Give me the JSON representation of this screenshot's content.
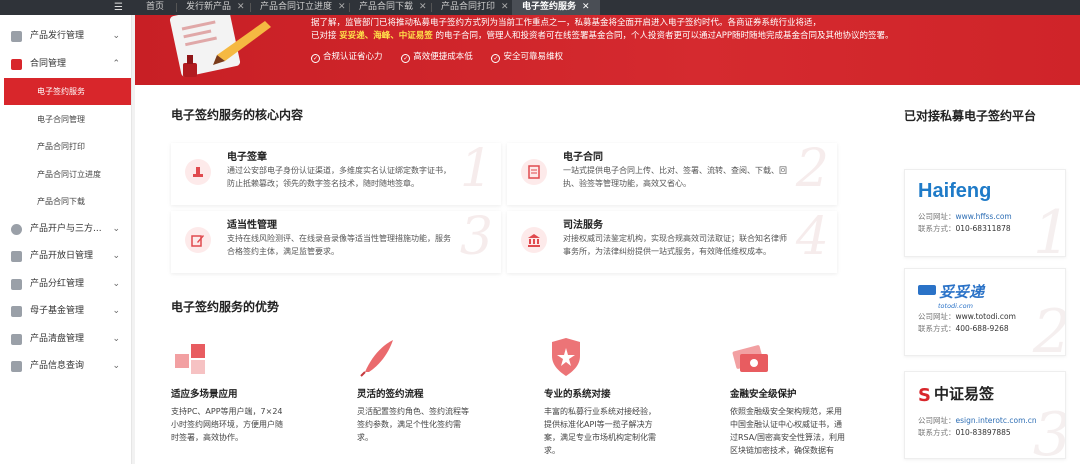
{
  "tabs": [
    {
      "label": "首页",
      "active": false
    },
    {
      "label": "发行新产品",
      "active": false
    },
    {
      "label": "产品合同订立进度",
      "active": false
    },
    {
      "label": "产品合同下载",
      "active": false
    },
    {
      "label": "产品合同打印",
      "active": false
    },
    {
      "label": "电子签约服务",
      "active": true
    }
  ],
  "sidebar": {
    "items": [
      {
        "label": "产品发行管理"
      },
      {
        "label": "合同管理"
      },
      {
        "label": "产品开户与三方..."
      },
      {
        "label": "产品开放日管理"
      },
      {
        "label": "产品分红管理"
      },
      {
        "label": "母子基金管理"
      },
      {
        "label": "产品清盘管理"
      },
      {
        "label": "产品信息查询"
      }
    ],
    "sub": [
      {
        "label": "电子签约服务"
      },
      {
        "label": "电子合同管理"
      },
      {
        "label": "产品合同打印"
      },
      {
        "label": "产品合同订立进度"
      },
      {
        "label": "产品合同下载"
      }
    ]
  },
  "banner": {
    "line1": "据了解，监管部门已将推动私募电子签约方式列为当前工作重点之一，私募基金将全面开启进入电子签约时代。各商证券系统行业将适，",
    "line2_pre": "已对接",
    "line2_hl": "妥妥递、海峰、中证易签",
    "line2_post": "的电子合同，管理人和投资者可在线签署基金合同，个人投资者更可以通过APP随时随地完成基金合同及其他协议的签署。",
    "badges": [
      "合规认证省心力",
      "高效便捷成本低",
      "安全可靠易维权"
    ]
  },
  "core": {
    "title": "电子签约服务的核心内容",
    "cards": [
      {
        "title": "电子签章",
        "desc": "通过公安部电子身份认证渠道，多维度实名认证绑定数字证书，防止抵赖篡改；领先的数字签名技术，随时随地签章。",
        "num": "1"
      },
      {
        "title": "电子合同",
        "desc": "一站式提供电子合同上传、比对、签署、流转、查阅、下载、回执、验签等管理功能，高效又省心。",
        "num": "2"
      },
      {
        "title": "适当性管理",
        "desc": "支持在线风险测评、在线录音录像等适当性管理措施功能，服务合格签约主体，满足监管要求。",
        "num": "3"
      },
      {
        "title": "司法服务",
        "desc": "对接权威司法鉴定机构，实现合规高效司法取证；联合知名律师事务所，为法律纠纷提供一站式服务，有效降低维权成本。",
        "num": "4"
      }
    ]
  },
  "adv": {
    "title": "电子签约服务的优势",
    "items": [
      {
        "title": "适应多场景应用",
        "desc": "支持PC、APP等用户端，7×24小时签约网络环境，方便用户随时签署，高效协作。"
      },
      {
        "title": "灵活的签约流程",
        "desc": "灵活配置签约角色、签约流程等签约参数，满足个性化签约需求。"
      },
      {
        "title": "专业的系统对接",
        "desc": "丰富的私募行业系统对接经验，提供标准化API等一揽子解决方案，满足专业市场机构定制化需求。"
      },
      {
        "title": "金融安全级保护",
        "desc": "依照金融级安全架构规范，采用中国金融认证中心权威证书，通过RSA/国密高安全性算法，利用区块链加密技术，确保数据有"
      }
    ]
  },
  "right": {
    "title": "已对接私募电子签约平台",
    "partners": [
      {
        "logo": "Haifeng",
        "site_label": "公司网址：",
        "site": "www.hffss.com",
        "phone_label": "联系方式：",
        "phone": "010-68311878",
        "num": "1"
      },
      {
        "logo": "妥妥递",
        "logo_sub": "totodi.com",
        "site_label": "公司网址：",
        "site": "www.totodi.com",
        "phone_label": "联系方式：",
        "phone": "400-688-9268",
        "num": "2"
      },
      {
        "logo": "中证易签",
        "site_label": "公司网址：",
        "site": "esign.interotc.com.cn",
        "phone_label": "联系方式：",
        "phone": "010-83897885",
        "num": "3"
      }
    ]
  },
  "colors": {
    "brand_red": "#d8262b",
    "banner_highlight": "#ffe24a",
    "topbar": "#2f3339"
  }
}
